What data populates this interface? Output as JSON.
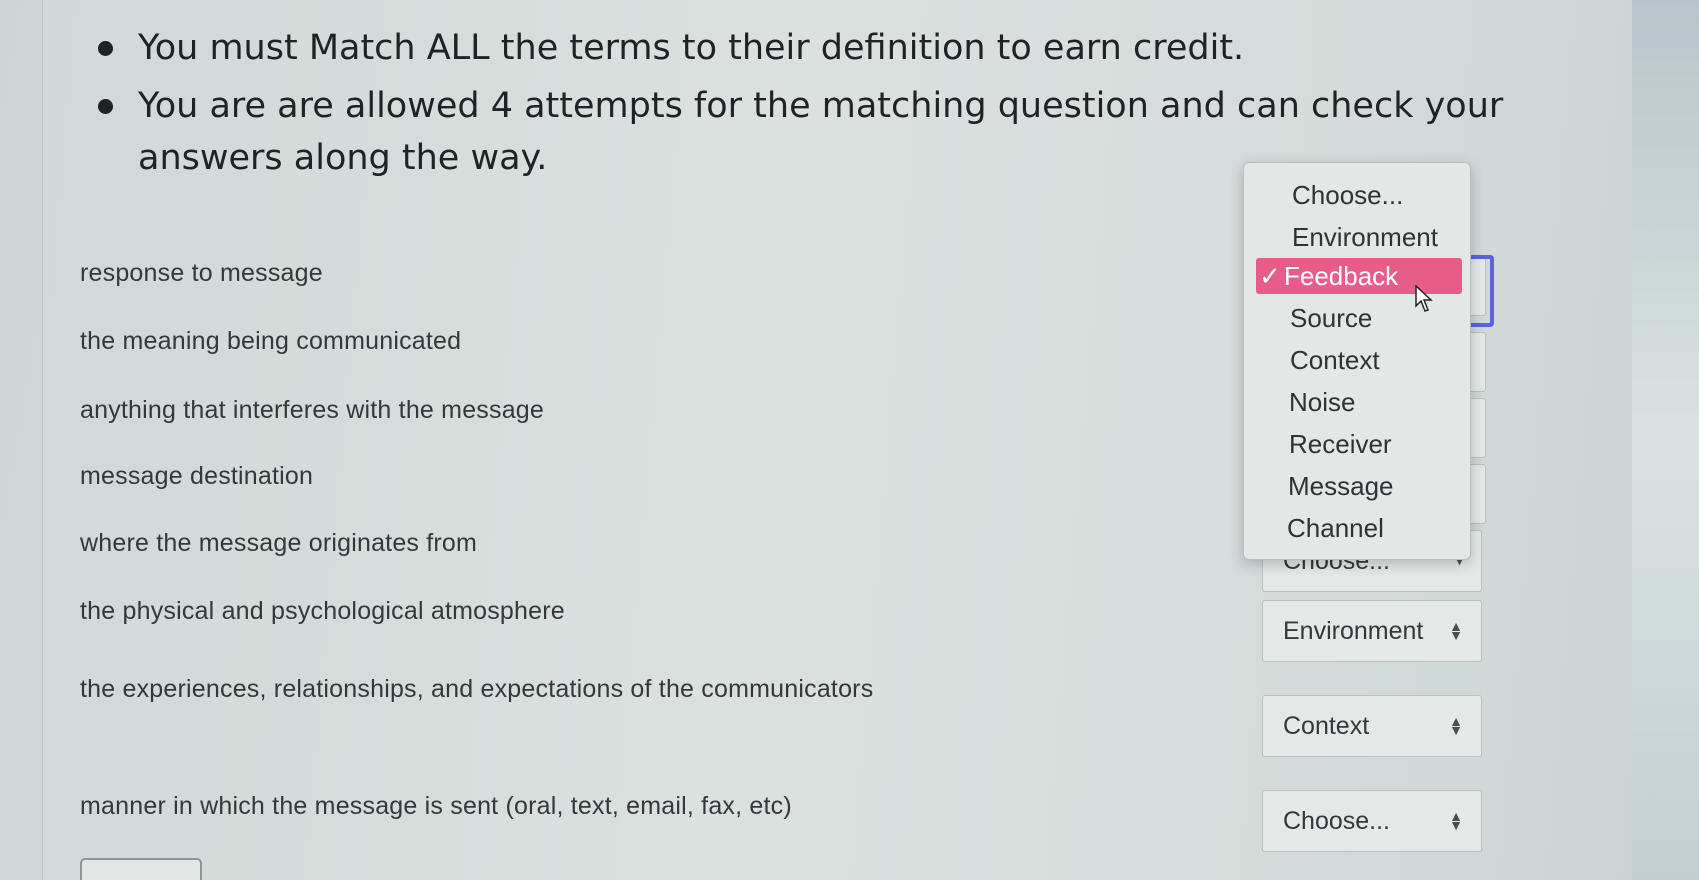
{
  "instructions": [
    {
      "text": "You must Match ALL the terms to their definition to earn credit."
    },
    {
      "text": "You are are allowed 4 attempts for the matching question and can check your answers along the way."
    }
  ],
  "terms": [
    "response to message",
    "the meaning being communicated",
    "anything that interferes with the message",
    "message destination",
    "where the message originates from",
    "the physical and psychological atmosphere",
    "the experiences, relationships, and expectations of the communicators",
    "manner in which the message is sent (oral, text, email, fax, etc)"
  ],
  "selects": {
    "row5": "Choose...",
    "row6": "Environment",
    "row7": "Context",
    "row8": "Choose..."
  },
  "dropdown": {
    "options": [
      "Choose...",
      "Environment",
      "Feedback",
      "Source",
      "Context",
      "Noise",
      "Receiver",
      "Message",
      "Channel"
    ],
    "selected": "Feedback",
    "check_mark": "✓",
    "highlight_color": "#e85c8a"
  }
}
